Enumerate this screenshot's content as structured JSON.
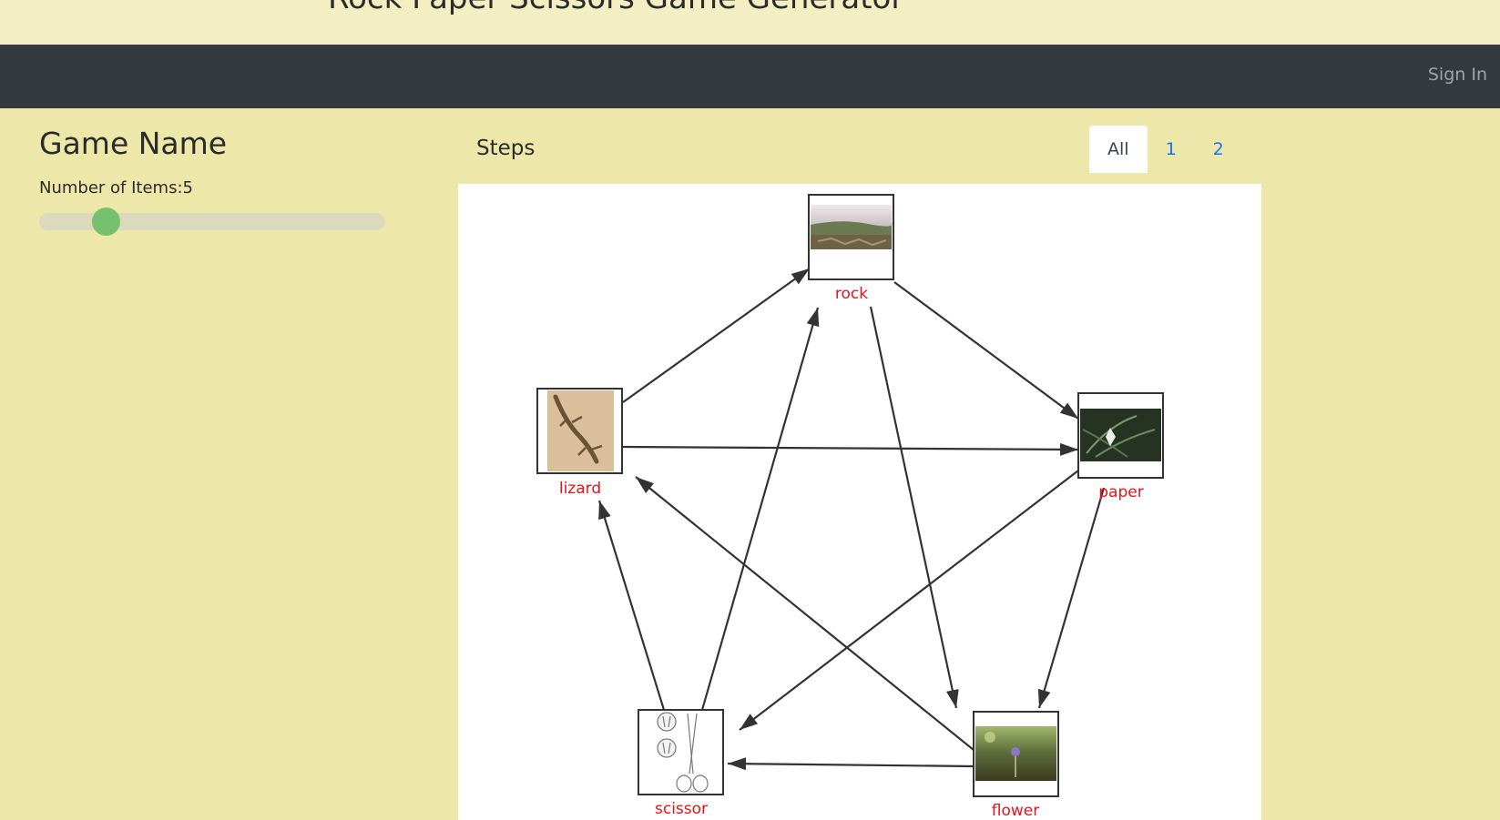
{
  "header": {
    "title": "Rock Paper Scissors Game Generator"
  },
  "nav": {
    "signin_label": "Sign In"
  },
  "sidebar": {
    "game_name": "Game Name",
    "items_label": "Number of Items:5",
    "items_count": 5
  },
  "steps": {
    "label": "Steps",
    "tabs": [
      "All",
      "1",
      "2"
    ],
    "active_tab": "All"
  },
  "graph": {
    "nodes": [
      "rock",
      "paper",
      "flower",
      "scissor",
      "lizard"
    ],
    "edges": [
      [
        "rock",
        "paper"
      ],
      [
        "rock",
        "flower"
      ],
      [
        "paper",
        "flower"
      ],
      [
        "paper",
        "scissor"
      ],
      [
        "flower",
        "scissor"
      ],
      [
        "flower",
        "lizard"
      ],
      [
        "scissor",
        "lizard"
      ],
      [
        "scissor",
        "rock"
      ],
      [
        "lizard",
        "rock"
      ],
      [
        "lizard",
        "paper"
      ]
    ]
  }
}
